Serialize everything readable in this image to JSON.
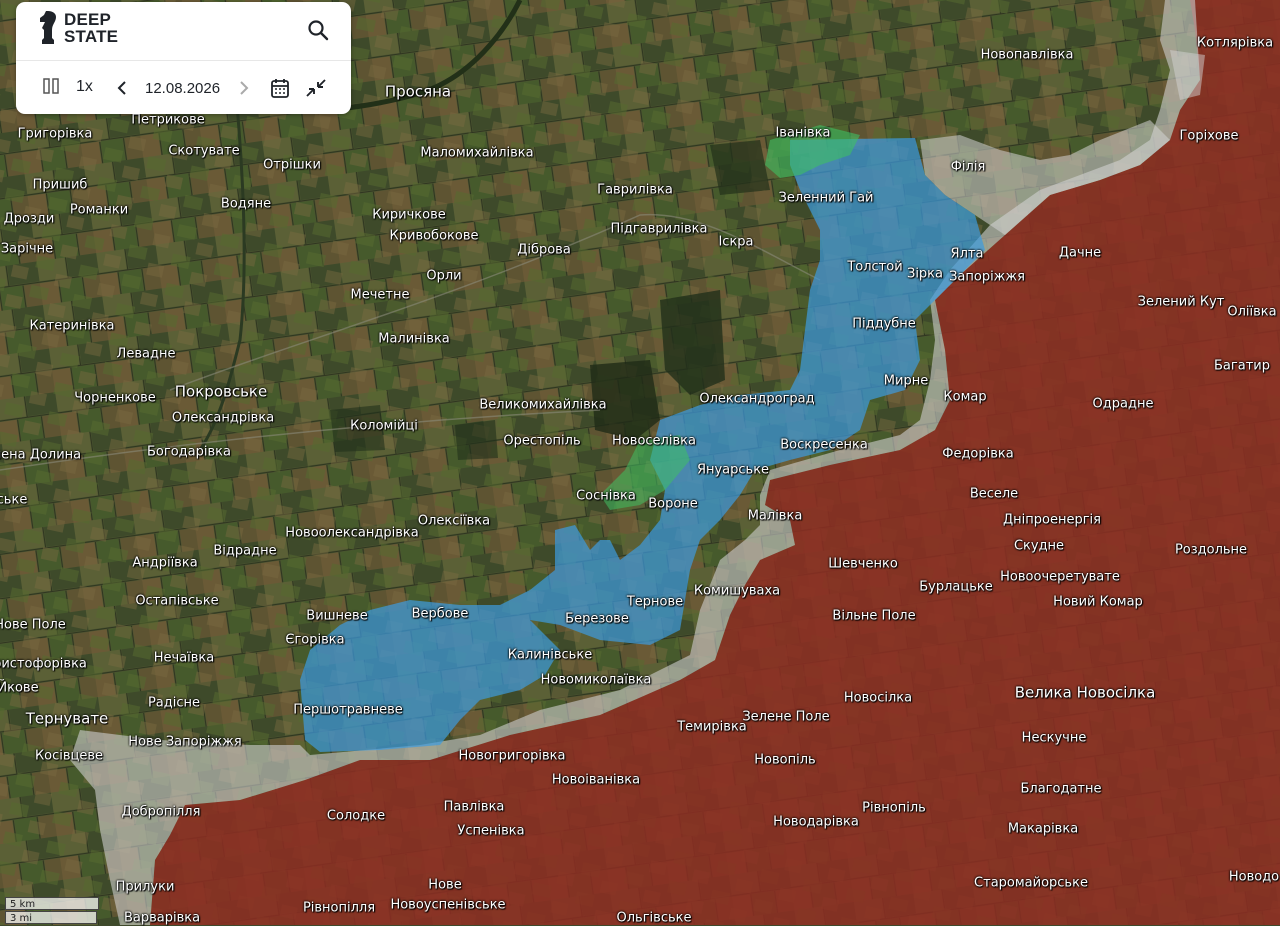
{
  "app": {
    "brand_line1": "DEEP",
    "brand_line2": "STATE"
  },
  "controls": {
    "search_icon": "search-icon",
    "pause_icon": "pause-icon",
    "speed": "1x",
    "prev_icon": "chevron-left-icon",
    "date": "12.08.2026",
    "next_icon": "chevron-right-icon",
    "calendar_icon": "calendar-icon",
    "compress_icon": "compress-arrows-icon"
  },
  "colors": {
    "occupied": "#8e2d22",
    "contested": "#c8c8c8",
    "liberated": "#3d9be0",
    "liberated_recent": "#3fbf62",
    "terrain": "#3f4a2c"
  },
  "scale": {
    "km": "5 km",
    "mi": "3 mi"
  },
  "places": [
    "Новопавлівка",
    "Котлярівка",
    "Горіхове",
    "Іванівка",
    "Філія",
    "Просяна",
    "Петрикове",
    "Григорівка",
    "Скотувате",
    "Маломихайлівка",
    "Отрішки",
    "Пришиб",
    "Романки",
    "Водяне",
    "Гаврилівка",
    "Дрозди",
    "Киричкове",
    "Підгаврилівка",
    "Зеленний Гай",
    "Зарічне",
    "Кривобокове",
    "Діброва",
    "Іскра",
    "Ялта",
    "Дачне",
    "Толстой",
    "Зірка",
    "Запоріжжя",
    "Орли",
    "Мечетне",
    "Зелений Кут",
    "Оліївка",
    "Катеринівка",
    "Малинівка",
    "Піддубне",
    "Левадне",
    "Покровське",
    "Багатир",
    "Мирне",
    "Чорненкове",
    "Олександрівка",
    "Великомихайлівка",
    "Олександроград",
    "Комар",
    "Одрадне",
    "Коломійці",
    "Новоселівка",
    "Воскресенка",
    "лена Долина",
    "Богодарівка",
    "Орестопіль",
    "Федорівка",
    "Януарське",
    "ське",
    "Соснівка",
    "Вороне",
    "Веселе",
    "Малівка",
    "Дніпроенергія",
    "Олексіївка",
    "Новоолександрівка",
    "Скудне",
    "Відрадне",
    "Роздольне",
    "Андріївка",
    "Шевченко",
    "Новоочеретувате",
    "Остапівське",
    "Бурлацьке",
    "Тернове",
    "Комишуваха",
    "Новий Комар",
    "Нове Поле",
    "Вишневе",
    "Вербове",
    "Березове",
    "Вільне Поле",
    "Єгорівка",
    "Нечаївка",
    "Калинівське",
    "ристофорівка",
    "Новомиколаївка",
    "Велика Новосілка",
    "Йкове",
    "Радісне",
    "Новосілка",
    "Першотравневе",
    "Тернувате",
    "Зелене Поле",
    "Темирівка",
    "Нескучне",
    "Нове Запоріжжя",
    "Косівцеве",
    "Новогригорівка",
    "Новопіль",
    "Новоіванівка",
    "Благодатне",
    "Добропілля",
    "Павлівка",
    "Рівнопіль",
    "Солодке",
    "Новодарівка",
    "Успенівка",
    "Макарівка",
    "Прилуки",
    "Нове",
    "Старомайорське",
    "Новодо",
    "Рівнопілля",
    "Новоуспенівське",
    "Варварівка",
    "Ольгівське"
  ]
}
